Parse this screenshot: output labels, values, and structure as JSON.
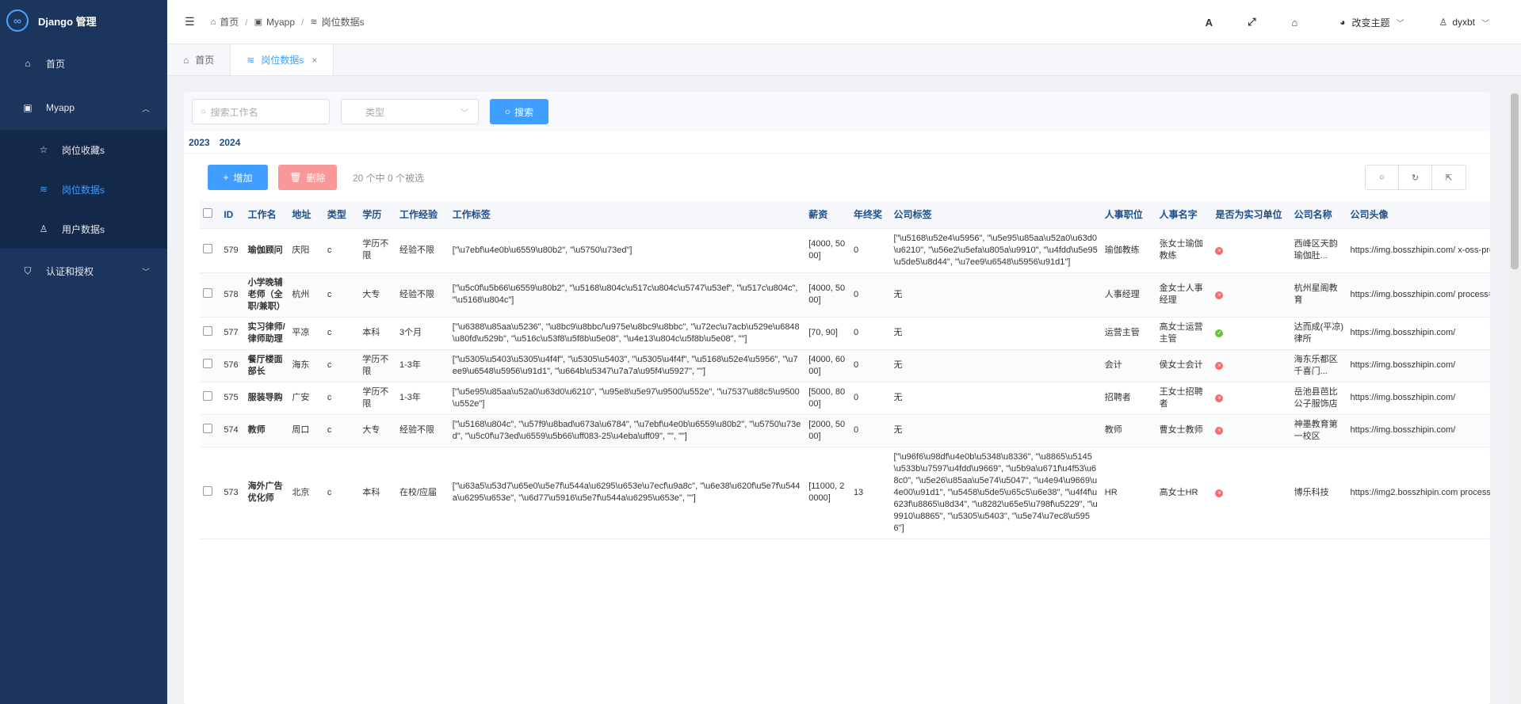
{
  "brand": {
    "title": "Django 管理",
    "logo_glyph": "∞"
  },
  "sidebar": {
    "items": [
      {
        "label": "首页",
        "icon": "home-icon"
      },
      {
        "label": "Myapp",
        "icon": "app-icon",
        "expanded": true,
        "children": [
          {
            "label": "岗位收藏s",
            "icon": "star-icon",
            "active": false
          },
          {
            "label": "岗位数据s",
            "icon": "database-icon",
            "active": true
          },
          {
            "label": "用户数据s",
            "icon": "user-icon",
            "active": false
          }
        ]
      },
      {
        "label": "认证和授权",
        "icon": "shield-icon",
        "expanded": false
      }
    ]
  },
  "header": {
    "breadcrumb": [
      "首页",
      "Myapp",
      "岗位数据s"
    ],
    "theme_label": "改变主题",
    "user_name": "dyxbt"
  },
  "tabs": [
    {
      "label": "首页",
      "active": false
    },
    {
      "label": "岗位数据s",
      "active": true
    }
  ],
  "search": {
    "placeholder": "搜索工作名",
    "select_placeholder": "类型",
    "button_label": "搜索"
  },
  "years": [
    "2023",
    "2024"
  ],
  "actions": {
    "add_label": "增加",
    "delete_label": "删除",
    "selection_text": "20 个中 0 个被选"
  },
  "table": {
    "columns": [
      "ID",
      "工作名",
      "地址",
      "类型",
      "学历",
      "工作经验",
      "工作标签",
      "薪资",
      "年终奖",
      "公司标签",
      "人事职位",
      "人事名字",
      "是否为实习单位",
      "公司名称",
      "公司头像"
    ],
    "rows": [
      {
        "id": "579",
        "name": "瑜伽顾问",
        "addr": "庆阳",
        "type": "c",
        "edu": "学历不限",
        "exp": "经验不限",
        "tags": "[\"\\u7ebf\\u4e0b\\u6559\\u80b2\", \"\\u5750\\u73ed\"]",
        "salary": "[4000, 5000]",
        "bonus": "0",
        "ctags": "[\"\\u5168\\u52e4\\u5956\", \"\\u5e95\\u85aa\\u52a0\\u63d0\\u6210\", \"\\u56e2\\u5efa\\u805a\\u9910\", \"\\u4fdd\\u5e95\\u5de5\\u8d44\", \"\\u7ee9\\u6548\\u5956\\u91d1\"]",
        "hr_pos": "瑜伽教练",
        "hr_name": "张女士瑜伽教练",
        "intern": false,
        "company": "西峰区天韵瑜伽肚...",
        "avatar": "https://img.bosszhipin.com/ x-oss-process=image/resize"
      },
      {
        "id": "578",
        "name": "小学晚辅老师（全职/兼职）",
        "addr": "杭州",
        "type": "c",
        "edu": "大专",
        "exp": "经验不限",
        "tags": "[\"\\u5c0f\\u5b66\\u6559\\u80b2\", \"\\u5168\\u804c\\u517c\\u804c\\u5747\\u53ef\", \"\\u517c\\u804c\", \"\\u5168\\u804c\"]",
        "salary": "[4000, 5000]",
        "bonus": "0",
        "ctags": "无",
        "hr_pos": "人事经理",
        "hr_name": "金女士人事经理",
        "intern": false,
        "company": "杭州星阁教育",
        "avatar": "https://img.bosszhipin.com/ process=image/resize,w_10("
      },
      {
        "id": "577",
        "name": "实习律师/律师助理",
        "addr": "平凉",
        "type": "c",
        "edu": "本科",
        "exp": "3个月",
        "tags": "[\"\\u6388\\u85aa\\u5236\", \"\\u8bc9\\u8bbc/\\u975e\\u8bc9\\u8bbc\", \"\\u72ec\\u7acb\\u529e\\u6848\\u80fd\\u529b\", \"\\u516c\\u53f8\\u5f8b\\u5e08\", \"\\u4e13\\u804c\\u5f8b\\u5e08\", \"\"]",
        "salary": "[70, 90]",
        "bonus": "0",
        "ctags": "无",
        "hr_pos": "运营主管",
        "hr_name": "高女士运营主管",
        "intern": true,
        "company": "达而成(平凉)律所",
        "avatar": "https://img.bosszhipin.com/"
      },
      {
        "id": "576",
        "name": "餐厅楼面部长",
        "addr": "海东",
        "type": "c",
        "edu": "学历不限",
        "exp": "1-3年",
        "tags": "[\"\\u5305\\u5403\\u5305\\u4f4f\", \"\\u5305\\u5403\", \"\\u5305\\u4f4f\", \"\\u5168\\u52e4\\u5956\", \"\\u7ee9\\u6548\\u5956\\u91d1\", \"\\u664b\\u5347\\u7a7a\\u95f4\\u5927\", \"\"]",
        "salary": "[4000, 6000]",
        "bonus": "0",
        "ctags": "无",
        "hr_pos": "会计",
        "hr_name": "侯女士会计",
        "intern": false,
        "company": "海东乐都区千喜门...",
        "avatar": "https://img.bosszhipin.com/"
      },
      {
        "id": "575",
        "name": "服装导购",
        "addr": "广安",
        "type": "c",
        "edu": "学历不限",
        "exp": "1-3年",
        "tags": "[\"\\u5e95\\u85aa\\u52a0\\u63d0\\u6210\", \"\\u95e8\\u5e97\\u9500\\u552e\", \"\\u7537\\u88c5\\u9500\\u552e\"]",
        "salary": "[5000, 8000]",
        "bonus": "0",
        "ctags": "无",
        "hr_pos": "招聘者",
        "hr_name": "王女士招聘者",
        "intern": false,
        "company": "岳池县芭比公子服饰店",
        "avatar": "https://img.bosszhipin.com/"
      },
      {
        "id": "574",
        "name": "教师",
        "addr": "周口",
        "type": "c",
        "edu": "大专",
        "exp": "经验不限",
        "tags": "[\"\\u5168\\u804c\", \"\\u57f9\\u8bad\\u673a\\u6784\", \"\\u7ebf\\u4e0b\\u6559\\u80b2\", \"\\u5750\\u73ed\", \"\\u5c0f\\u73ed\\u6559\\u5b66\\uff083-25\\u4eba\\uff09\", \"\", \"\"]",
        "salary": "[2000, 5000]",
        "bonus": "0",
        "ctags": "无",
        "hr_pos": "教师",
        "hr_name": "曹女士教师",
        "intern": false,
        "company": "神墨教育第一校区",
        "avatar": "https://img.bosszhipin.com/"
      },
      {
        "id": "573",
        "name": "海外广告优化师",
        "addr": "北京",
        "type": "c",
        "edu": "本科",
        "exp": "在校/应届",
        "tags": "[\"\\u63a5\\u53d7\\u65e0\\u5e7f\\u544a\\u6295\\u653e\\u7ecf\\u9a8c\", \"\\u6e38\\u620f\\u5e7f\\u544a\\u6295\\u653e\", \"\\u6d77\\u5916\\u5e7f\\u544a\\u6295\\u653e\", \"\"]",
        "salary": "[11000, 20000]",
        "bonus": "13",
        "ctags": "[\"\\u96f6\\u98df\\u4e0b\\u5348\\u8336\", \"\\u8865\\u5145\\u533b\\u7597\\u4fdd\\u9669\", \"\\u5b9a\\u671f\\u4f53\\u68c0\", \"\\u5e26\\u85aa\\u5e74\\u5047\", \"\\u4e94\\u9669\\u4e00\\u91d1\", \"\\u5458\\u5de5\\u65c5\\u6e38\", \"\\u4f4f\\u623f\\u8865\\u8d34\", \"\\u8282\\u65e5\\u798f\\u5229\", \"\\u9910\\u8865\", \"\\u5305\\u5403\", \"\\u5e74\\u7ec8\\u5956\"]",
        "hr_pos": "HR",
        "hr_name": "高女士HR",
        "intern": false,
        "company": "博乐科技",
        "avatar": "https://img2.bosszhipin.com process=image/resize,w_10("
      }
    ]
  },
  "colors": {
    "sidebar": "#1c355c",
    "accent": "#409eff",
    "danger": "#f89898",
    "header_text": "#1d4e89"
  }
}
